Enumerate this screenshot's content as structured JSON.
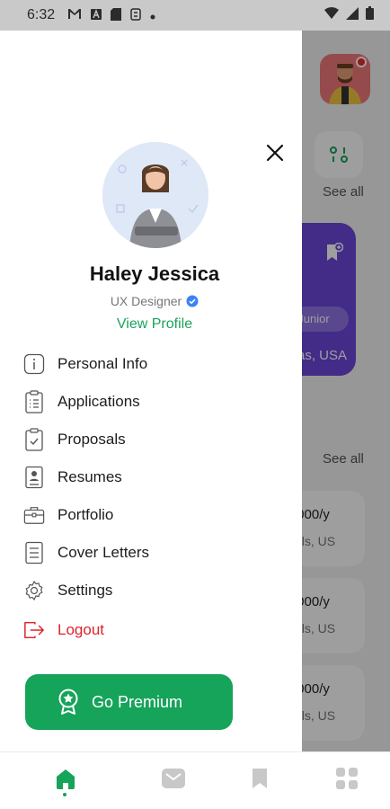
{
  "status_bar": {
    "time": "6:32",
    "icons": [
      "gmail-icon",
      "app-a-icon",
      "sd-card-icon",
      "sync-icon",
      "dot-icon",
      "wifi-icon",
      "signal-icon",
      "battery-icon"
    ]
  },
  "background_app": {
    "see_all_1": "See all",
    "chip": "Junior",
    "location_1": "as, USA",
    "see_all_2": "See all",
    "jobs": [
      {
        "salary": ",000/y",
        "location": "els, US"
      },
      {
        "salary": ",000/y",
        "location": "els, US"
      },
      {
        "salary": ",000/y",
        "location": "els, US"
      }
    ],
    "accent_purple": "#6b47dc"
  },
  "drawer": {
    "name": "Haley Jessica",
    "role": "UX Designer",
    "view_profile": "View Profile",
    "menu": [
      {
        "label": "Personal Info",
        "icon": "info-icon"
      },
      {
        "label": "Applications",
        "icon": "list-icon"
      },
      {
        "label": "Proposals",
        "icon": "clipboard-check-icon"
      },
      {
        "label": "Resumes",
        "icon": "resume-icon"
      },
      {
        "label": "Portfolio",
        "icon": "briefcase-icon"
      },
      {
        "label": "Cover Letters",
        "icon": "document-icon"
      },
      {
        "label": "Settings",
        "icon": "gear-icon"
      },
      {
        "label": "Logout",
        "icon": "logout-icon"
      }
    ],
    "premium_label": "Go Premium",
    "brand_green": "#16a35a",
    "logout_red": "#e0222a"
  },
  "bottom_nav": {
    "items": [
      "home-icon",
      "mail-icon",
      "bookmark-icon",
      "grid-icon"
    ],
    "active": "home-icon"
  }
}
